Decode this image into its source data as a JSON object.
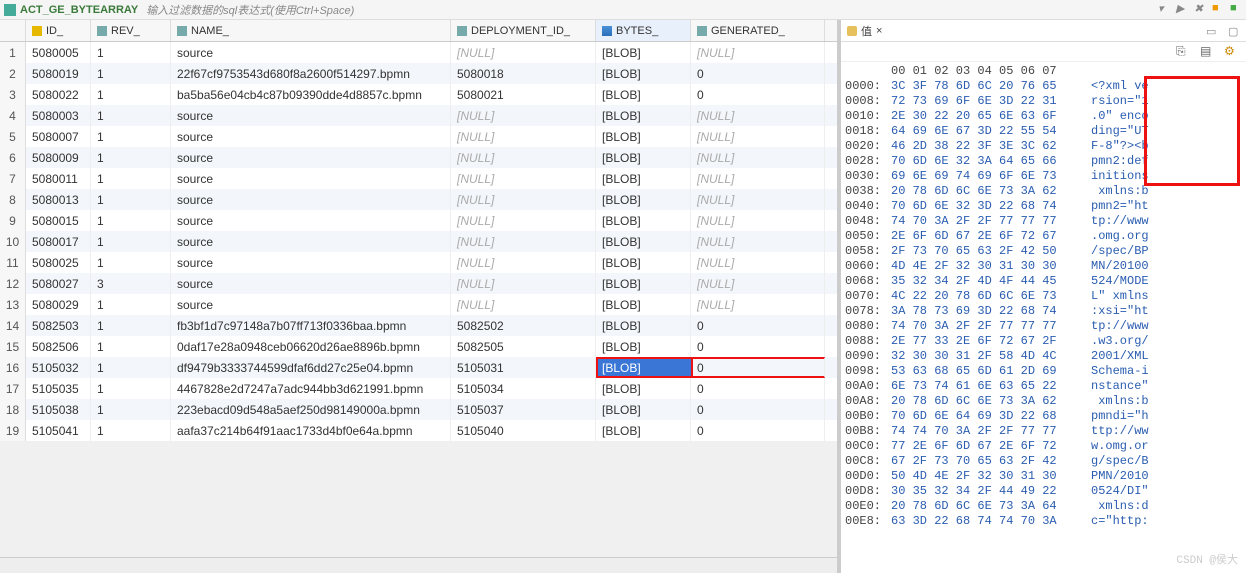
{
  "table_name": "ACT_GE_BYTEARRAY",
  "filter_hint": "输入过滤数据的sql表达式(使用Ctrl+Space)",
  "columns": [
    {
      "label": "",
      "type": "rownum"
    },
    {
      "label": "ID_",
      "type": "key"
    },
    {
      "label": "REV_",
      "type": "txt"
    },
    {
      "label": "NAME_",
      "type": "txt"
    },
    {
      "label": "DEPLOYMENT_ID_",
      "type": "txt"
    },
    {
      "label": "BYTES_",
      "type": "bytes"
    },
    {
      "label": "GENERATED_",
      "type": "txt"
    }
  ],
  "rows": [
    {
      "n": "1",
      "id": "5080005",
      "rev": "1",
      "name": "source",
      "dep": "[NULL]",
      "bytes": "[BLOB]",
      "gen": "[NULL]"
    },
    {
      "n": "2",
      "id": "5080019",
      "rev": "1",
      "name": "22f67cf9753543d680f8a2600f514297.bpmn",
      "dep": "5080018",
      "bytes": "[BLOB]",
      "gen": "0"
    },
    {
      "n": "3",
      "id": "5080022",
      "rev": "1",
      "name": "ba5ba56e04cb4c87b09390dde4d8857c.bpmn",
      "dep": "5080021",
      "bytes": "[BLOB]",
      "gen": "0"
    },
    {
      "n": "4",
      "id": "5080003",
      "rev": "1",
      "name": "source",
      "dep": "[NULL]",
      "bytes": "[BLOB]",
      "gen": "[NULL]"
    },
    {
      "n": "5",
      "id": "5080007",
      "rev": "1",
      "name": "source",
      "dep": "[NULL]",
      "bytes": "[BLOB]",
      "gen": "[NULL]"
    },
    {
      "n": "6",
      "id": "5080009",
      "rev": "1",
      "name": "source",
      "dep": "[NULL]",
      "bytes": "[BLOB]",
      "gen": "[NULL]"
    },
    {
      "n": "7",
      "id": "5080011",
      "rev": "1",
      "name": "source",
      "dep": "[NULL]",
      "bytes": "[BLOB]",
      "gen": "[NULL]"
    },
    {
      "n": "8",
      "id": "5080013",
      "rev": "1",
      "name": "source",
      "dep": "[NULL]",
      "bytes": "[BLOB]",
      "gen": "[NULL]"
    },
    {
      "n": "9",
      "id": "5080015",
      "rev": "1",
      "name": "source",
      "dep": "[NULL]",
      "bytes": "[BLOB]",
      "gen": "[NULL]"
    },
    {
      "n": "10",
      "id": "5080017",
      "rev": "1",
      "name": "source",
      "dep": "[NULL]",
      "bytes": "[BLOB]",
      "gen": "[NULL]"
    },
    {
      "n": "11",
      "id": "5080025",
      "rev": "1",
      "name": "source",
      "dep": "[NULL]",
      "bytes": "[BLOB]",
      "gen": "[NULL]"
    },
    {
      "n": "12",
      "id": "5080027",
      "rev": "3",
      "name": "source",
      "dep": "[NULL]",
      "bytes": "[BLOB]",
      "gen": "[NULL]"
    },
    {
      "n": "13",
      "id": "5080029",
      "rev": "1",
      "name": "source",
      "dep": "[NULL]",
      "bytes": "[BLOB]",
      "gen": "[NULL]"
    },
    {
      "n": "14",
      "id": "5082503",
      "rev": "1",
      "name": "fb3bf1d7c97148a7b07ff713f0336baa.bpmn",
      "dep": "5082502",
      "bytes": "[BLOB]",
      "gen": "0"
    },
    {
      "n": "15",
      "id": "5082506",
      "rev": "1",
      "name": "0daf17e28a0948ceb06620d26ae8896b.bpmn",
      "dep": "5082505",
      "bytes": "[BLOB]",
      "gen": "0"
    },
    {
      "n": "16",
      "id": "5105032",
      "rev": "1",
      "name": "df9479b3333744599dfaf6dd27c25e04.bpmn",
      "dep": "5105031",
      "bytes": "[BLOB]",
      "gen": "0",
      "selected": true
    },
    {
      "n": "17",
      "id": "5105035",
      "rev": "1",
      "name": "4467828e2d7247a7adc944bb3d621991.bpmn",
      "dep": "5105034",
      "bytes": "[BLOB]",
      "gen": "0"
    },
    {
      "n": "18",
      "id": "5105038",
      "rev": "1",
      "name": "223ebacd09d548a5aef250d98149000a.bpmn",
      "dep": "5105037",
      "bytes": "[BLOB]",
      "gen": "0"
    },
    {
      "n": "19",
      "id": "5105041",
      "rev": "1",
      "name": "aafa37c214b64f91aac1733d4bf0e64a.bpmn",
      "dep": "5105040",
      "bytes": "[BLOB]",
      "gen": "0"
    }
  ],
  "hex_tab": {
    "label": "值",
    "close": "×"
  },
  "hex_header": "00 01 02 03 04 05 06 07",
  "hex_rows": [
    {
      "off": "0000:",
      "b": "3C 3F 78 6D 6C 20 76 65",
      "a": "<?xml ve"
    },
    {
      "off": "0008:",
      "b": "72 73 69 6F 6E 3D 22 31",
      "a": "rsion=\"1"
    },
    {
      "off": "0010:",
      "b": "2E 30 22 20 65 6E 63 6F",
      "a": ".0\" enco"
    },
    {
      "off": "0018:",
      "b": "64 69 6E 67 3D 22 55 54",
      "a": "ding=\"UT"
    },
    {
      "off": "0020:",
      "b": "46 2D 38 22 3F 3E 3C 62",
      "a": "F-8\"?><b"
    },
    {
      "off": "0028:",
      "b": "70 6D 6E 32 3A 64 65 66",
      "a": "pmn2:def"
    },
    {
      "off": "0030:",
      "b": "69 6E 69 74 69 6F 6E 73",
      "a": "initions"
    },
    {
      "off": "0038:",
      "b": "20 78 6D 6C 6E 73 3A 62",
      "a": " xmlns:b"
    },
    {
      "off": "0040:",
      "b": "70 6D 6E 32 3D 22 68 74",
      "a": "pmn2=\"ht"
    },
    {
      "off": "0048:",
      "b": "74 70 3A 2F 2F 77 77 77",
      "a": "tp://www"
    },
    {
      "off": "0050:",
      "b": "2E 6F 6D 67 2E 6F 72 67",
      "a": ".omg.org"
    },
    {
      "off": "0058:",
      "b": "2F 73 70 65 63 2F 42 50",
      "a": "/spec/BP"
    },
    {
      "off": "0060:",
      "b": "4D 4E 2F 32 30 31 30 30",
      "a": "MN/20100"
    },
    {
      "off": "0068:",
      "b": "35 32 34 2F 4D 4F 44 45",
      "a": "524/MODE"
    },
    {
      "off": "0070:",
      "b": "4C 22 20 78 6D 6C 6E 73",
      "a": "L\" xmlns"
    },
    {
      "off": "0078:",
      "b": "3A 78 73 69 3D 22 68 74",
      "a": ":xsi=\"ht"
    },
    {
      "off": "0080:",
      "b": "74 70 3A 2F 2F 77 77 77",
      "a": "tp://www"
    },
    {
      "off": "0088:",
      "b": "2E 77 33 2E 6F 72 67 2F",
      "a": ".w3.org/"
    },
    {
      "off": "0090:",
      "b": "32 30 30 31 2F 58 4D 4C",
      "a": "2001/XML"
    },
    {
      "off": "0098:",
      "b": "53 63 68 65 6D 61 2D 69",
      "a": "Schema-i"
    },
    {
      "off": "00A0:",
      "b": "6E 73 74 61 6E 63 65 22",
      "a": "nstance\""
    },
    {
      "off": "00A8:",
      "b": "20 78 6D 6C 6E 73 3A 62",
      "a": " xmlns:b"
    },
    {
      "off": "00B0:",
      "b": "70 6D 6E 64 69 3D 22 68",
      "a": "pmndi=\"h"
    },
    {
      "off": "00B8:",
      "b": "74 74 70 3A 2F 2F 77 77",
      "a": "ttp://ww"
    },
    {
      "off": "00C0:",
      "b": "77 2E 6F 6D 67 2E 6F 72",
      "a": "w.omg.or"
    },
    {
      "off": "00C8:",
      "b": "67 2F 73 70 65 63 2F 42",
      "a": "g/spec/B"
    },
    {
      "off": "00D0:",
      "b": "50 4D 4E 2F 32 30 31 30",
      "a": "PMN/2010"
    },
    {
      "off": "00D8:",
      "b": "30 35 32 34 2F 44 49 22",
      "a": "0524/DI\""
    },
    {
      "off": "00E0:",
      "b": "20 78 6D 6C 6E 73 3A 64",
      "a": " xmlns:d"
    },
    {
      "off": "00E8:",
      "b": "63 3D 22 68 74 74 70 3A",
      "a": "c=\"http:"
    }
  ],
  "watermark": "CSDN @侯大"
}
